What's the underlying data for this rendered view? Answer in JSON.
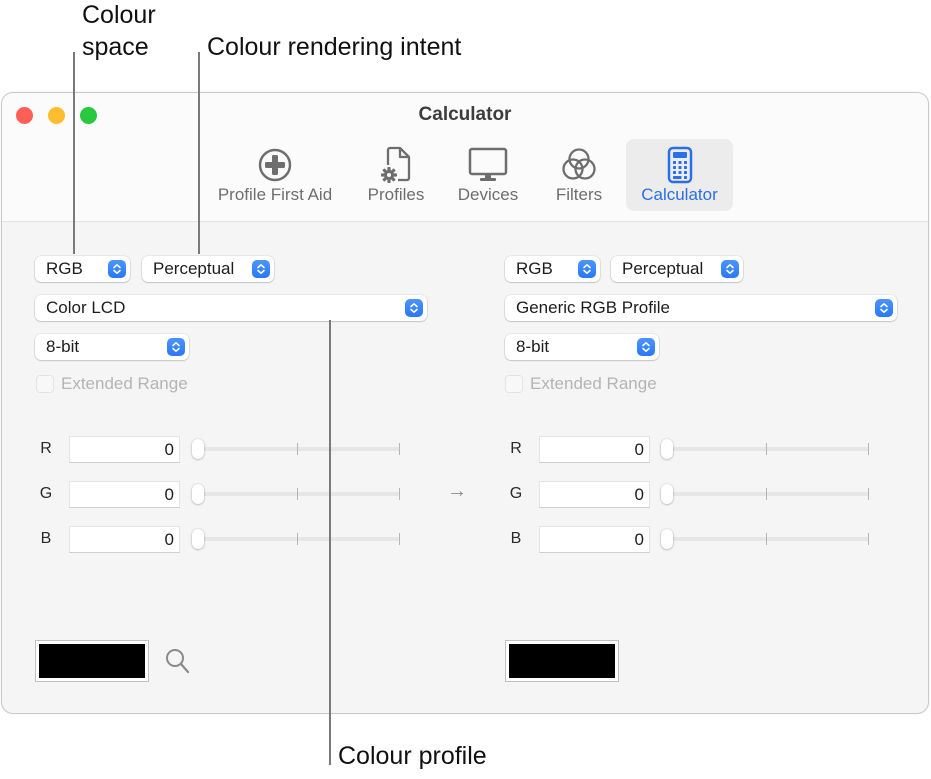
{
  "callouts": {
    "colour_space_line1": "Colour",
    "colour_space_line2": "space",
    "rendering_intent": "Colour rendering intent",
    "colour_profile": "Colour profile"
  },
  "window": {
    "title": "Calculator",
    "traffic_lights": {
      "close": "#fe5f57",
      "minimize": "#febc2e",
      "maximize": "#28c840"
    }
  },
  "toolbar": {
    "items": [
      {
        "label": "Profile First Aid",
        "icon": "plus-circle-icon",
        "active": false
      },
      {
        "label": "Profiles",
        "icon": "document-gear-icon",
        "active": false
      },
      {
        "label": "Devices",
        "icon": "monitor-icon",
        "active": false
      },
      {
        "label": "Filters",
        "icon": "venn-circles-icon",
        "active": false
      },
      {
        "label": "Calculator",
        "icon": "calculator-icon",
        "active": true
      }
    ],
    "accent_color": "#2b6fe6"
  },
  "source": {
    "colour_space": "RGB",
    "rendering_intent": "Perceptual",
    "profile": "Color LCD",
    "bit_depth": "8-bit",
    "extended_range": {
      "label": "Extended Range",
      "checked": false,
      "enabled": false
    },
    "channels": [
      {
        "label": "R",
        "value": "0",
        "slider_fraction": 0
      },
      {
        "label": "G",
        "value": "0",
        "slider_fraction": 0
      },
      {
        "label": "B",
        "value": "0",
        "slider_fraction": 0
      }
    ],
    "swatch_color": "#000000"
  },
  "conversion_arrow": "→",
  "destination": {
    "colour_space": "RGB",
    "rendering_intent": "Perceptual",
    "profile": "Generic RGB Profile",
    "bit_depth": "8-bit",
    "extended_range": {
      "label": "Extended Range",
      "checked": false,
      "enabled": false
    },
    "channels": [
      {
        "label": "R",
        "value": "0",
        "slider_fraction": 0
      },
      {
        "label": "G",
        "value": "0",
        "slider_fraction": 0
      },
      {
        "label": "B",
        "value": "0",
        "slider_fraction": 0
      }
    ],
    "swatch_color": "#000000"
  }
}
